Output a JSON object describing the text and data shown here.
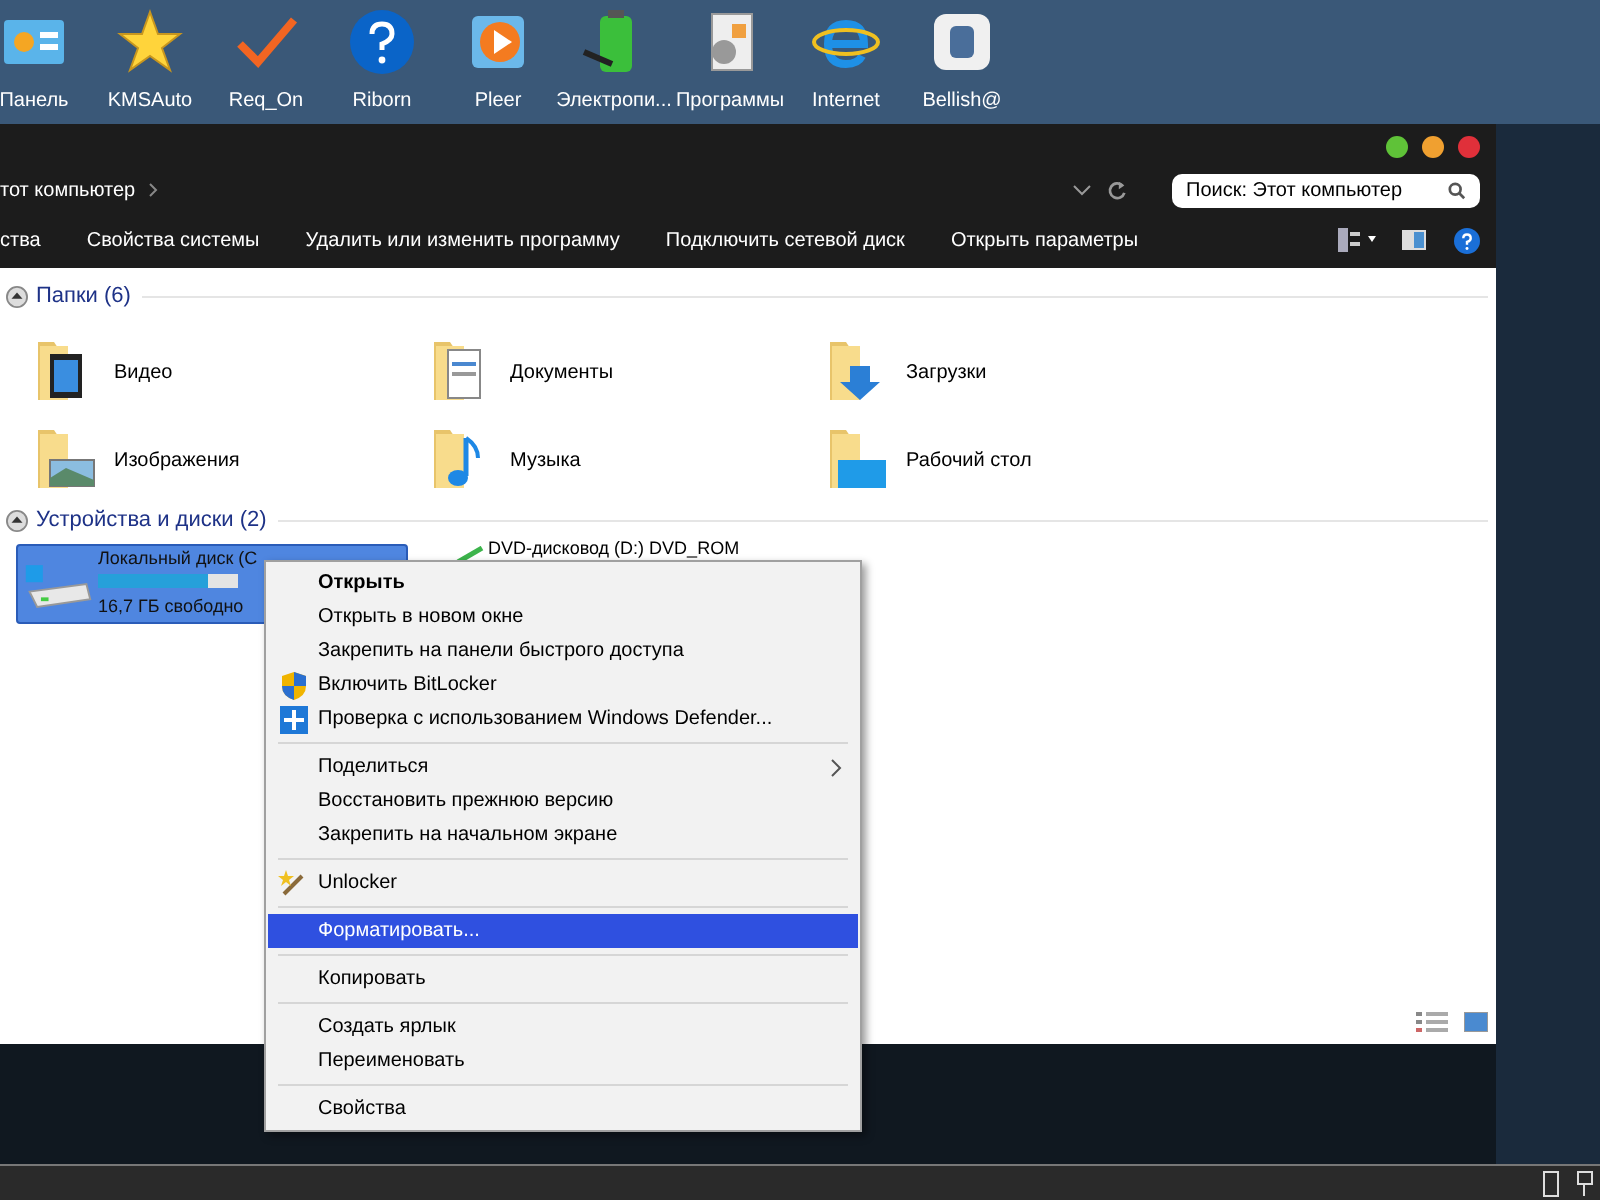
{
  "desktop_icons": [
    {
      "label": "Панель"
    },
    {
      "label": "KMSAuto"
    },
    {
      "label": "Req_On"
    },
    {
      "label": "Riborn"
    },
    {
      "label": "Pleer"
    },
    {
      "label": "Электропи..."
    },
    {
      "label": "Программы"
    },
    {
      "label": "Internet"
    },
    {
      "label": "Bellish@"
    }
  ],
  "window": {
    "address": "тот компьютер",
    "search": {
      "placeholder": "Поиск: Этот компьютер"
    },
    "commands": [
      "ства",
      "Свойства системы",
      "Удалить или изменить программу",
      "Подключить сетевой диск",
      "Открыть параметры"
    ],
    "groups": [
      {
        "title": "Папки (6)",
        "expanded": true,
        "items": [
          {
            "label": "Видео"
          },
          {
            "label": "Документы"
          },
          {
            "label": "Загрузки"
          },
          {
            "label": "Изображения"
          },
          {
            "label": "Музыка"
          },
          {
            "label": "Рабочий стол"
          }
        ]
      },
      {
        "title": "Устройства и диски (2)",
        "expanded": true,
        "drives": [
          {
            "label": "Локальный диск (C",
            "free": "16,7 ГБ свободно",
            "level": 0.78,
            "selected": true
          },
          {
            "label": "DVD-дисковод (D:) DVD_ROM",
            "selected": false
          }
        ]
      }
    ]
  },
  "context_menu": [
    [
      {
        "label": "Открыть",
        "bold": true,
        "selected": false,
        "submenu": false
      },
      {
        "label": "Открыть в новом окне",
        "bold": false,
        "selected": false,
        "submenu": false
      },
      {
        "label": "Закрепить на панели быстрого доступа",
        "bold": false,
        "selected": false,
        "submenu": false
      },
      {
        "label": "Включить BitLocker",
        "bold": false,
        "selected": false,
        "submenu": false
      },
      {
        "label": "Проверка с использованием Windows Defender...",
        "bold": false,
        "selected": false,
        "submenu": false
      }
    ],
    [
      {
        "label": "Поделиться",
        "bold": false,
        "selected": false,
        "submenu": true
      },
      {
        "label": "Восстановить прежнюю версию",
        "bold": false,
        "selected": false,
        "submenu": false
      },
      {
        "label": "Закрепить на начальном экране",
        "bold": false,
        "selected": false,
        "submenu": false
      }
    ],
    [
      {
        "label": "Unlocker",
        "bold": false,
        "selected": false,
        "submenu": false
      }
    ],
    [
      {
        "label": "Форматировать...",
        "bold": false,
        "selected": true,
        "submenu": false
      }
    ],
    [
      {
        "label": "Копировать",
        "bold": false,
        "selected": false,
        "submenu": false
      }
    ],
    [
      {
        "label": "Создать ярлык",
        "bold": false,
        "selected": false,
        "submenu": false
      },
      {
        "label": "Переименовать",
        "bold": false,
        "selected": false,
        "submenu": false
      }
    ],
    [
      {
        "label": "Свойства",
        "bold": false,
        "selected": false,
        "submenu": false
      }
    ]
  ]
}
